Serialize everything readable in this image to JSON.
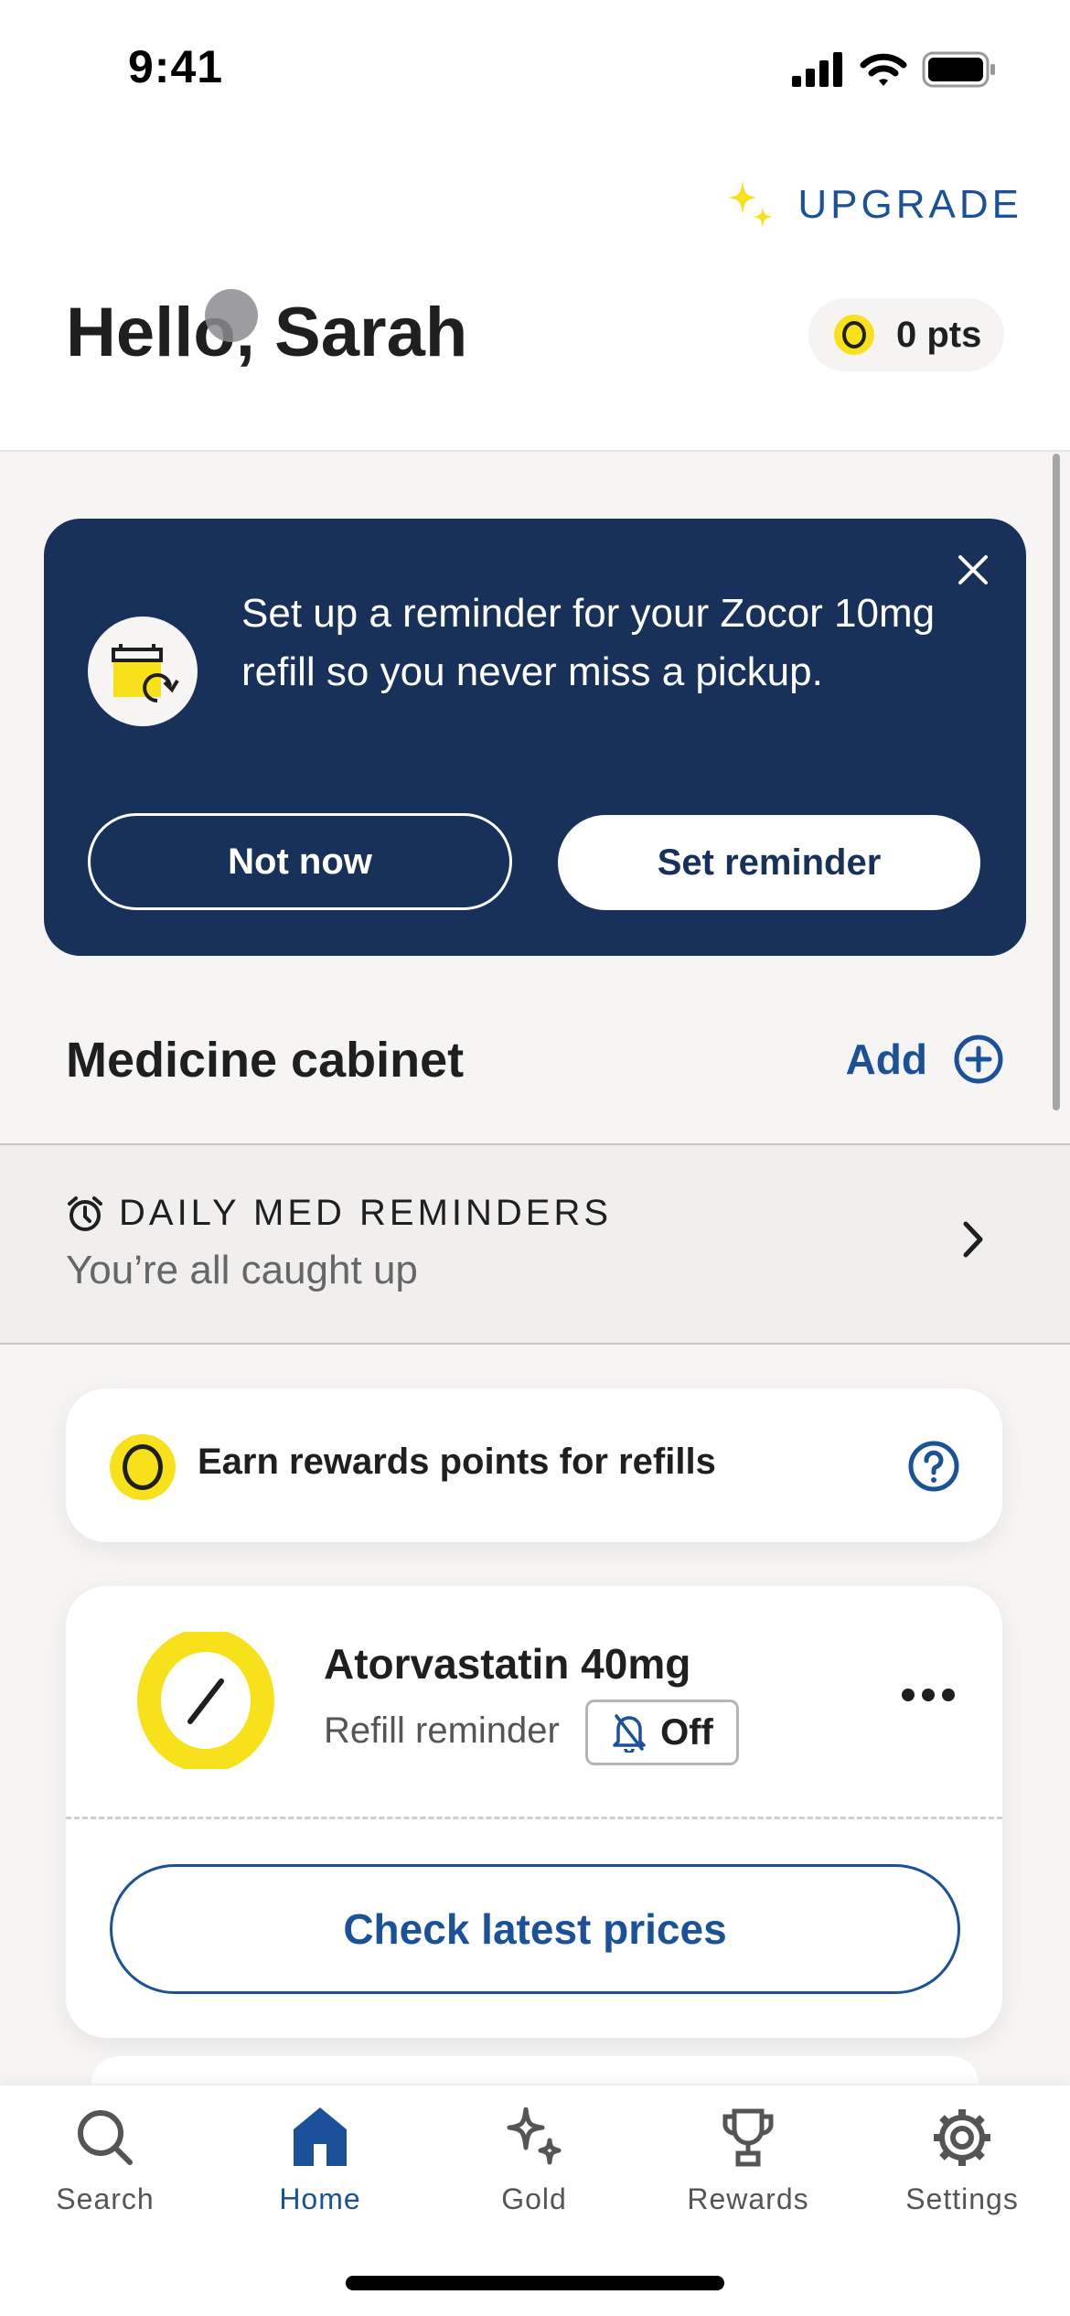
{
  "status_bar": {
    "time": "9:41"
  },
  "header": {
    "upgrade_label": "UPGRADE",
    "greeting": "Hello, Sarah",
    "points": "0 pts"
  },
  "banner": {
    "message": "Set up a reminder for your Zocor 10mg refill so you never miss a pickup.",
    "not_now_label": "Not now",
    "set_reminder_label": "Set reminder"
  },
  "cabinet": {
    "title": "Medicine cabinet",
    "add_label": "Add"
  },
  "daily_reminders": {
    "label": "DAILY MED REMINDERS",
    "status": "You’re all caught up"
  },
  "rewards": {
    "text": "Earn rewards points for refills"
  },
  "medication": {
    "name": "Atorvastatin 40mg",
    "refill_label": "Refill reminder",
    "refill_state": "Off",
    "action_label": "Check latest prices"
  },
  "tabbar": {
    "items": [
      {
        "label": "Search",
        "icon": "search-icon",
        "active": false
      },
      {
        "label": "Home",
        "icon": "home-icon",
        "active": true
      },
      {
        "label": "Gold",
        "icon": "sparkle-icon",
        "active": false
      },
      {
        "label": "Rewards",
        "icon": "trophy-icon",
        "active": false
      },
      {
        "label": "Settings",
        "icon": "gear-icon",
        "active": false
      }
    ]
  },
  "colors": {
    "brand_blue": "#1b5199",
    "banner_navy": "#17315a",
    "accent_yellow": "#f7e11b",
    "background": "#f6f5f4"
  }
}
